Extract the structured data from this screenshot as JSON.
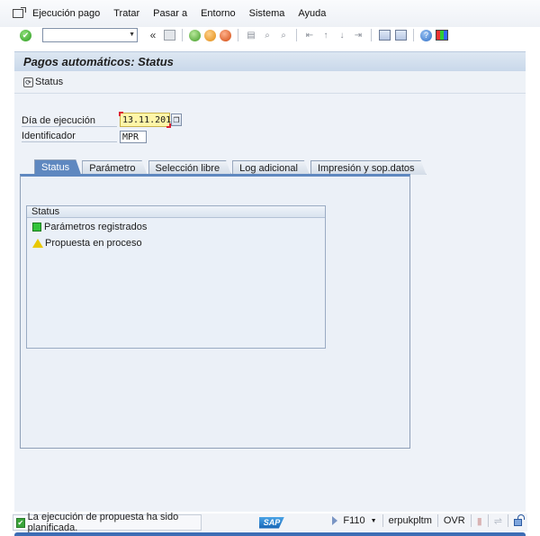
{
  "menu": {
    "items": [
      "Ejecución pago",
      "Tratar",
      "Pasar a",
      "Entorno",
      "Sistema",
      "Ayuda"
    ]
  },
  "window_controls": {
    "minimize": "▂",
    "maximize": "□",
    "close": "✕"
  },
  "toolbar": {
    "command_value": "",
    "history_glyph": "«"
  },
  "header": {
    "title": "Pagos automáticos: Status"
  },
  "app_toolbar": {
    "status_button_label": "Status"
  },
  "form": {
    "run_date_label": "Día de ejecución",
    "run_date_value": "13.11.2019",
    "identifier_label": "Identificador",
    "identifier_value": "MPR"
  },
  "tabs": [
    {
      "label": "Status",
      "active": true
    },
    {
      "label": "Parámetro",
      "active": false
    },
    {
      "label": "Selección libre",
      "active": false
    },
    {
      "label": "Log adicional",
      "active": false
    },
    {
      "label": "Impresión y sop.datos",
      "active": false
    }
  ],
  "status_group": {
    "title": "Status",
    "items": [
      {
        "label": "Parámetros registrados",
        "indicator": "green-square"
      },
      {
        "label": "Propuesta en proceso",
        "indicator": "yellow-triangle"
      }
    ]
  },
  "statusbar": {
    "message": "La ejecución de propuesta ha sido planificada.",
    "logo": "SAP",
    "transaction": "F110",
    "server": "erpukpltm",
    "mode": "OVR"
  },
  "colors": {
    "active_tab": "#5f88c0",
    "date_field_bg": "#fff6a8",
    "status_green": "#33c43a",
    "status_yellow": "#e8c800"
  }
}
